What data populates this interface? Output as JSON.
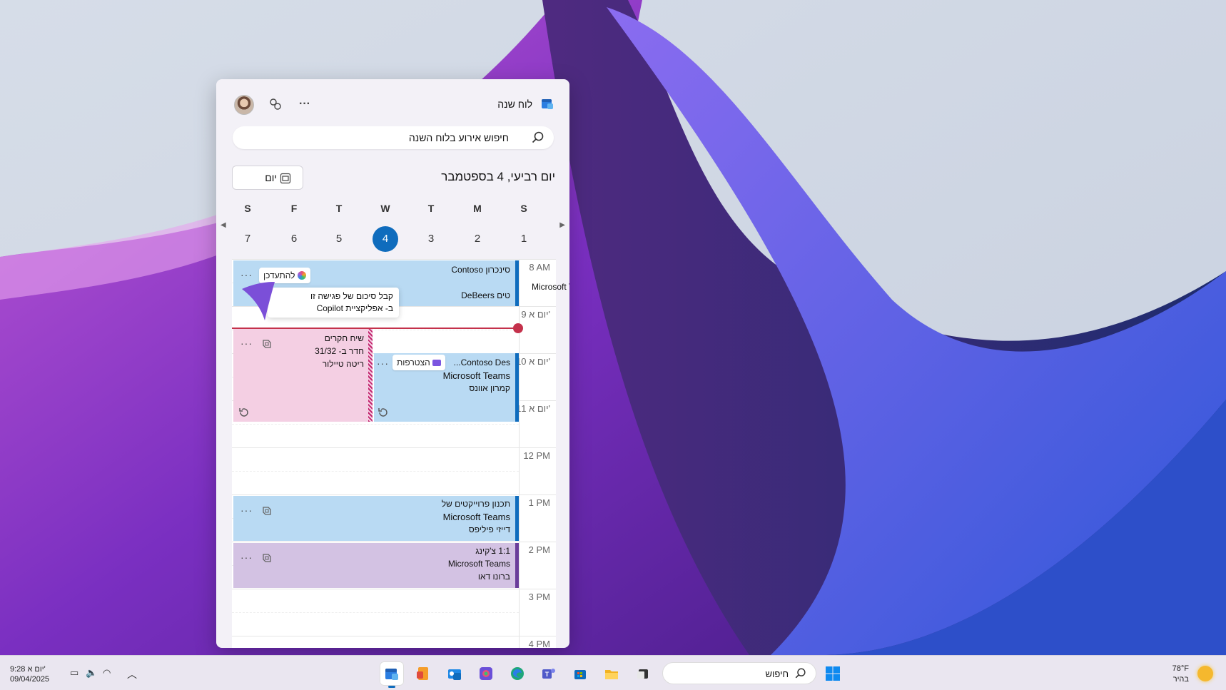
{
  "panel": {
    "app_title": "לוח שנה",
    "more_label": "···",
    "search": {
      "placeholder": "חיפוש אירוע בלוח השנה"
    },
    "view_button": {
      "label": "יום"
    },
    "date_title": "יום רביעי, 4 בספטמבר",
    "weekdays": [
      "S",
      "M",
      "T",
      "W",
      "T",
      "F",
      "S"
    ],
    "days": [
      "1",
      "2",
      "3",
      "4",
      "5",
      "6",
      "7"
    ],
    "selected_day": "4"
  },
  "timeline": {
    "hours": [
      "8 AM",
      "9 יום א'",
      "10 יום א'",
      "11 יום א'",
      "12 PM",
      "1 PM",
      "2 PM",
      "3 PM",
      "4 PM"
    ],
    "events": {
      "contoso_sync": {
        "title": "סינכרון Contoso",
        "app": "Microsoft Teams",
        "line3": "טים DeBeers",
        "chip_label": "להתעדכן",
        "more": "···"
      },
      "copilot_tip": {
        "line1": "קבל סיכום של פגישה זו",
        "line2": "ב- אפליקציית Copilot"
      },
      "research": {
        "title": "שיח חקרים",
        "room": "חדר ב- 31/32",
        "person": "ריטה טיילור",
        "more": "···"
      },
      "contoso_design": {
        "title": "Contoso Des...",
        "app": "Microsoft Teams",
        "person": "קמרון אוונס",
        "chip_label": "הצטרפות",
        "more": "···"
      },
      "project_planning": {
        "title": "תכנון פרוייקטים של",
        "app": "Microsoft Teams",
        "person": "דייזי פיליפס",
        "more": "···"
      },
      "one_on_one": {
        "title": "1:1 צ'קינג",
        "app": "Microsoft Teams",
        "person": "ברונו דאו",
        "more": "···"
      }
    }
  },
  "taskbar": {
    "time": "9:28 יום א'",
    "date": "09/04/2025",
    "search_placeholder": "חיפוש",
    "weather_temp": "78°F",
    "weather_desc": "בהיר"
  },
  "colors": {
    "accent": "#0f6cbd",
    "now_line": "#c4314b",
    "event_blue": "#b9daf3",
    "event_pink": "#f4cfe3",
    "event_purple": "#d3c2e3"
  }
}
